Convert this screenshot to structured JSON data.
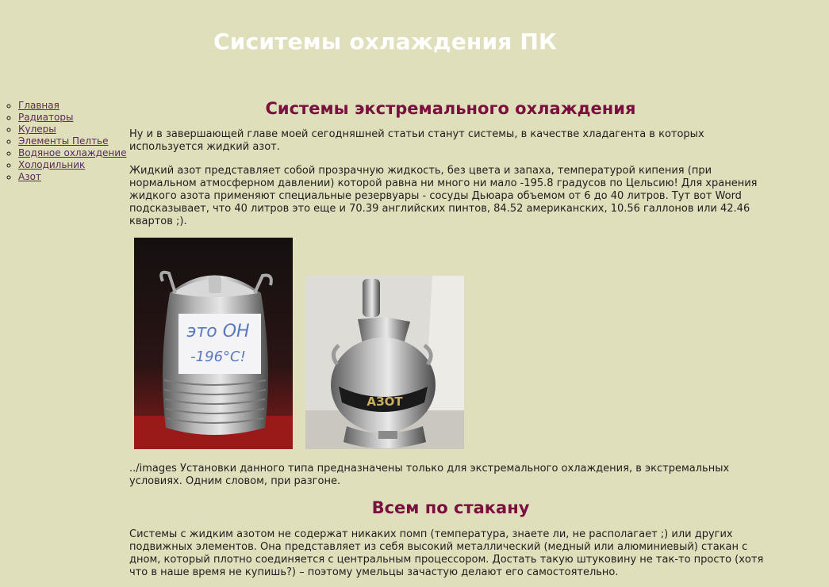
{
  "header": {
    "title": "Сиситемы охлаждения ПК"
  },
  "nav": {
    "items": [
      {
        "label": "Главная"
      },
      {
        "label": "Радиаторы"
      },
      {
        "label": "Кулеры"
      },
      {
        "label": "Элементы Пелтье"
      },
      {
        "label": "Водяное охлаждение"
      },
      {
        "label": "Холодильник"
      },
      {
        "label": "Азот"
      }
    ]
  },
  "content": {
    "heading_1": "Системы экстремального охлаждения",
    "para_1": "Ну и в завершающей главе моей сегодняшней статьи станут системы, в качестве хладагента в которых используется жидкий азот.",
    "para_2": "Жидкий азот представляет собой прозрачную жидкость, без цвета и запаха, температурой кипения (при нормальном атмосферном давлении) которой равна ни много ни мало -195.8 градусов по Цельсию! Для хранения жидкого азота применяют специальные резервуары - сосуды Дьюара объемом от 6 до 40 литров. Тут вот Word подсказывает, что 40 литров это еще и 70.39 английских пинтов, 84.52 американских, 10.56 галлонов или 42.46 квартов ;).",
    "photo_1_sign_line1": "это ОН",
    "photo_1_sign_line2": "-196°C!",
    "photo_2_label": "АЗОТ",
    "para_3": "../images Установки данного типа предназначены только для экстремального охлаждения, в экстремальных условиях. Одним словом, при разгоне.",
    "heading_2": "Всем по стакану",
    "para_4": "Системы с жидким азотом не содержат никаких помп (температура, знаете ли, не располагает ;) или других подвижных элементов. Она представляет из себя высокий металлический (медный или алюминиевый) стакан с дном, который плотно соединяется с центральным процессором. Достать такую штуковину не так-то просто (хотя что в наше время не купишь?) – поэтому умельцы зачастую делают его самостоятельно."
  },
  "colors": {
    "background": "#e0dfbb",
    "title": "#ffffff",
    "heading": "#7a1040",
    "link": "#5a2a5a"
  }
}
